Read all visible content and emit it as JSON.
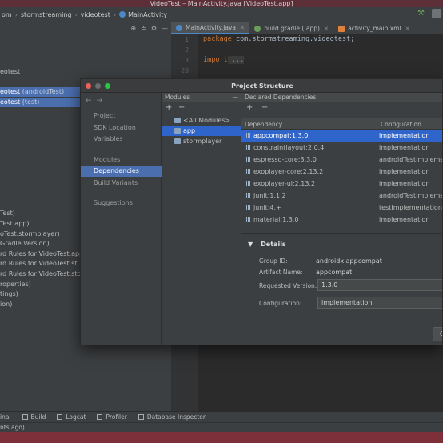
{
  "window": {
    "title": "VideoTest – MainActivity.java [VideoTest.app]"
  },
  "breadcrumbs": [
    "om",
    "stormstreaming",
    "videotest",
    "MainActivity"
  ],
  "project_tree": {
    "root": "eotest",
    "rows": [
      {
        "label": "eotest",
        "suffix": "(androidTest)",
        "selected": true
      },
      {
        "label": "eotest",
        "suffix": "(test)",
        "selected": true
      },
      {
        "label": "Test)",
        "suffix": "",
        "selected": false
      },
      {
        "label": "Test.app)",
        "suffix": "",
        "selected": false
      },
      {
        "label": "oTest.stormplayer)",
        "suffix": "",
        "selected": false
      },
      {
        "label": "Gradle Version)",
        "suffix": "",
        "selected": false
      },
      {
        "label": "rd Rules for VideoTest.app",
        "suffix": "",
        "selected": false
      },
      {
        "label": "rd Rules for VideoTest.st",
        "suffix": "",
        "selected": false
      },
      {
        "label": "rd Rules for VideoTest.sto",
        "suffix": "",
        "selected": false
      },
      {
        "label": "roperties)",
        "suffix": "",
        "selected": false
      },
      {
        "label": "tings)",
        "suffix": "",
        "selected": false
      },
      {
        "label": "ion)",
        "suffix": "",
        "selected": false
      }
    ]
  },
  "editor": {
    "tabs": [
      {
        "label": "MainActivity.java",
        "active": true,
        "color": "#4a88c7"
      },
      {
        "label": "build.gradle (:app)",
        "active": false,
        "color": "#6a9f5a"
      },
      {
        "label": "activity_main.xml",
        "active": false,
        "color": "#e0813a"
      }
    ],
    "line_numbers": [
      "1",
      "2",
      "3",
      "20"
    ],
    "code": {
      "line1_kw": "package",
      "line1_rest": " com.stormstreaming.videotest;",
      "line3_kw": "import",
      "line3_fold": " ..."
    }
  },
  "dialog": {
    "title": "Project Structure",
    "nav": {
      "items": [
        "Project",
        "SDK Location",
        "Variables",
        "Modules",
        "Dependencies",
        "Build Variants",
        "Suggestions"
      ],
      "selected": "Dependencies"
    },
    "modules": {
      "header": "Modules",
      "items": [
        "<All Modules>",
        "app",
        "stormplayer"
      ],
      "selected": "app"
    },
    "dependencies": {
      "header": "Declared Dependencies",
      "col_dependency": "Dependency",
      "col_configuration": "Configuration",
      "rows": [
        {
          "name": "appcompat:1.3.0",
          "config": "implementation",
          "selected": true
        },
        {
          "name": "constraintlayout:2.0.4",
          "config": "implementation",
          "selected": false
        },
        {
          "name": "espresso-core:3.3.0",
          "config": "androidTestImplemen",
          "selected": false
        },
        {
          "name": "exoplayer-core:2.13.2",
          "config": "implementation",
          "selected": false
        },
        {
          "name": "exoplayer-ui:2.13.2",
          "config": "implementation",
          "selected": false
        },
        {
          "name": "junit:1.1.2",
          "config": "androidTestImplemen",
          "selected": false
        },
        {
          "name": "junit:4.+",
          "config": "testImplementation",
          "selected": false
        },
        {
          "name": "material:1.3.0",
          "config": "implementation",
          "selected": false
        }
      ]
    },
    "details": {
      "title": "Details",
      "group_id_label": "Group ID:",
      "group_id": "androidx.appcompat",
      "artifact_label": "Artifact Name:",
      "artifact": "appcompat",
      "version_label": "Requested Version:",
      "version": "1.3.0",
      "config_label": "Configuration:",
      "config": "implementation"
    },
    "ok_label": "C"
  },
  "bottom_tools": [
    "inal",
    "Build",
    "Logcat",
    "Profiler",
    "Database Inspector"
  ],
  "status_text": "nts ago)",
  "colors": {
    "selection": "#2f65ca",
    "nav_selection": "#4b6eaf",
    "background": "#3c3f41",
    "editor_bg": "#2b2b2b"
  }
}
